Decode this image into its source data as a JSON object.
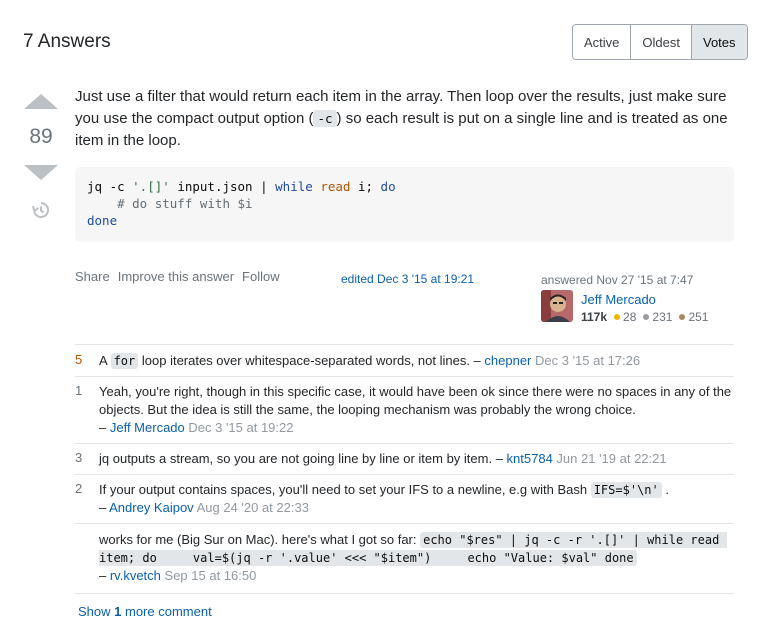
{
  "header": {
    "answers_count": "7 Answers",
    "sort_options": [
      "Active",
      "Oldest",
      "Votes"
    ],
    "sort_selected": "Votes"
  },
  "answer": {
    "score": "89",
    "body_part1": "Just use a filter that would return each item in the array. Then loop over the results, just make sure you use the compact output option (",
    "body_code": "-c",
    "body_part2": ") so each result is put on a single line and is treated as one item in the loop.",
    "code_lines": {
      "l1_a": "jq -c ",
      "l1_str": "'.[]'",
      "l1_b": " input.json | ",
      "l1_kw1": "while",
      "l1_sp1": " ",
      "l1_builtin": "read",
      "l1_c": " i; ",
      "l1_kw2": "do",
      "l2_comment": "    # do stuff with $i",
      "l3_kw": "done"
    },
    "menu": {
      "share": "Share",
      "improve": "Improve this answer",
      "follow": "Follow"
    },
    "edited": "edited Dec 3 '15 at 19:21",
    "answered": "answered Nov 27 '15 at 7:47",
    "user": {
      "name": "Jeff Mercado",
      "reputation": "117k",
      "gold": "28",
      "silver": "231",
      "bronze": "251"
    }
  },
  "colors": {
    "gold": "#f1b600",
    "silver": "#9a9c9f",
    "bronze": "#ab8a5f",
    "link": "#0a60b0",
    "hot_score": "#b75301"
  },
  "comments": [
    {
      "score": "5",
      "pre": "A ",
      "code": "for",
      "post": " loop iterates over whitespace-separated words, not lines. – ",
      "user": "chepner",
      "date": " Dec 3 '15 at 17:26"
    },
    {
      "score": "1",
      "text": "Yeah, you're right, though in this specific case, it would have been ok since there were no spaces in any of the objects. But the idea is still the same, the looping mechanism was probably the wrong choice.",
      "dash": "– ",
      "user": "Jeff Mercado",
      "date": " Dec 3 '15 at 19:22"
    },
    {
      "score": "3",
      "text": "jq outputs a stream, so you are not going line by line or item by item. – ",
      "user": "knt5784",
      "date": " Jun 21 '19 at 22:21"
    },
    {
      "score": "2",
      "pre": "If your output contains spaces, you'll need to set your IFS to a newline, e.g with Bash ",
      "code": "IFS=$'\\n'",
      "post": " .",
      "dash": "– ",
      "user": "Andrey Kaipov",
      "date": " Aug 24 '20 at 22:33"
    },
    {
      "score": "",
      "pre": "works for me (Big Sur on Mac). here's what I got so far: ",
      "code": "echo \"$res\" | jq -c -r '.[]' | while read item; do     val=$(jq -r '.value' <<< \"$item\")     echo \"Value: $val\" done",
      "dash": "– ",
      "user": "rv.kvetch",
      "date": " Sep 15 at 16:50"
    }
  ],
  "show_more": {
    "pre": "Show ",
    "count": "1",
    "post": " more comment"
  }
}
